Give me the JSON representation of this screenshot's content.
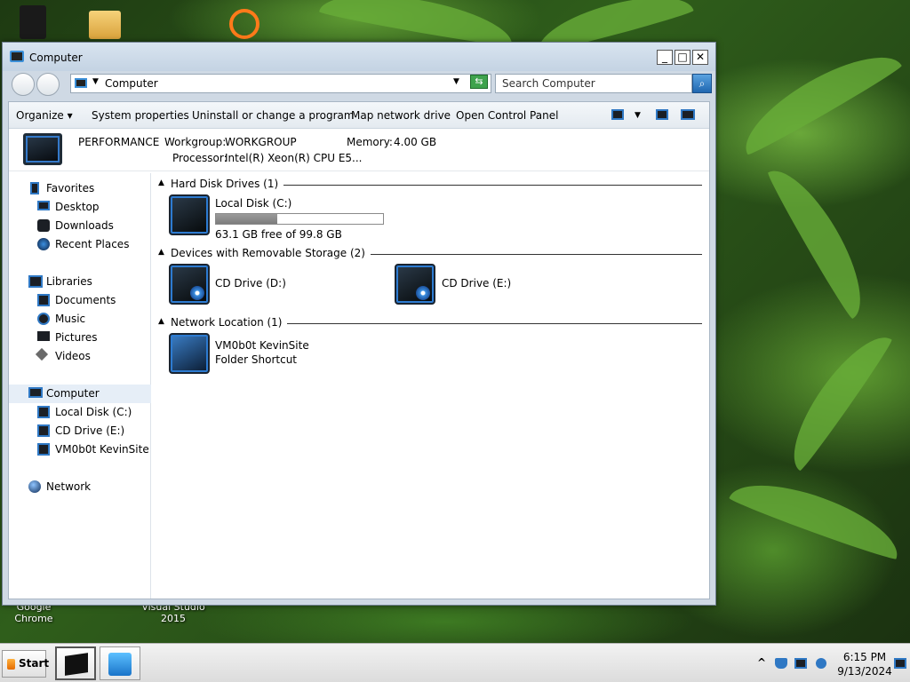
{
  "desktop": {
    "icons": [
      {
        "label_line1": "Google",
        "label_line2": "Chrome"
      },
      {
        "label_line1": "Visual Studio",
        "label_line2": "2015"
      }
    ]
  },
  "window": {
    "title": "Computer",
    "buttons": {
      "minimize": "_",
      "maximize": "□",
      "close": "✕"
    }
  },
  "address": {
    "path": "Computer",
    "search_placeholder": "Search Computer"
  },
  "toolbar": {
    "organize": "Organize",
    "system_properties": "System properties",
    "uninstall": "Uninstall or change a program",
    "map_drive": "Map network drive",
    "control_panel": "Open Control Panel"
  },
  "details": {
    "computer_name": "PERFORMANCE",
    "workgroup_label": "Workgroup:",
    "workgroup": "WORKGROUP",
    "memory_label": "Memory:",
    "memory": "4.00 GB",
    "processor_label": "Processor:",
    "processor": "Intel(R) Xeon(R) CPU E5..."
  },
  "nav": {
    "favorites": "Favorites",
    "desktop": "Desktop",
    "downloads": "Downloads",
    "recent_places": "Recent Places",
    "libraries": "Libraries",
    "documents": "Documents",
    "music": "Music",
    "pictures": "Pictures",
    "videos": "Videos",
    "computer": "Computer",
    "local_disk": "Local Disk (C:)",
    "cd_drive_e": "CD Drive (E:)",
    "vm0b0t": "VM0b0t KevinSite",
    "network": "Network"
  },
  "groups": {
    "hdd": "Hard Disk Drives (1)",
    "removable": "Devices with Removable Storage (2)",
    "network": "Network Location (1)"
  },
  "drives": {
    "local_disk": {
      "name": "Local Disk (C:)",
      "free_text": "63.1 GB free of 99.8 GB",
      "used_fraction": 0.368
    },
    "cd_d": {
      "name": "CD Drive (D:)"
    },
    "cd_e": {
      "name": "CD Drive (E:)"
    },
    "net": {
      "name": "VM0b0t KevinSite",
      "type": "Folder Shortcut"
    }
  },
  "taskbar": {
    "start": "Start",
    "tray_up": "^",
    "time": "6:15 PM",
    "date": "9/13/2024"
  }
}
